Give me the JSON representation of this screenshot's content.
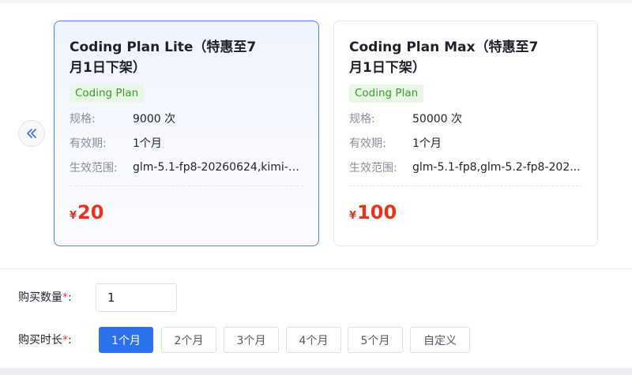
{
  "carousel": {
    "prev_icon": "double-chevron-left-icon",
    "cards": [
      {
        "title": "Coding Plan Lite（特惠至7月1日下架）",
        "tag": "Coding Plan",
        "spec_label": "规格:",
        "spec_value": "9000 次",
        "validity_label": "有效期:",
        "validity_value": "1个月",
        "scope_label": "生效范围:",
        "scope_value": "glm-5.1-fp8-20260624,kimi-2...",
        "currency": "¥",
        "price": "20",
        "selected": true
      },
      {
        "title": "Coding Plan Max（特惠至7月1日下架）",
        "tag": "Coding Plan",
        "spec_label": "规格:",
        "spec_value": "50000 次",
        "validity_label": "有效期:",
        "validity_value": "1个月",
        "scope_label": "生效范围:",
        "scope_value": "glm-5.1-fp8,glm-5.2-fp8-202...",
        "currency": "¥",
        "price": "100",
        "selected": false
      }
    ]
  },
  "form": {
    "quantity_label": "购买数量",
    "quantity_value": "1",
    "duration_label": "购买时长",
    "required_mark": "*",
    "colon": ":",
    "durations": [
      "1个月",
      "2个月",
      "3个月",
      "4个月",
      "5个月",
      "自定义"
    ],
    "selected_duration": "1个月"
  },
  "colors": {
    "accent": "#2b72ec",
    "price": "#e5341b",
    "tag_text": "#3a9b2a",
    "tag_bg": "#e9f7e6"
  }
}
